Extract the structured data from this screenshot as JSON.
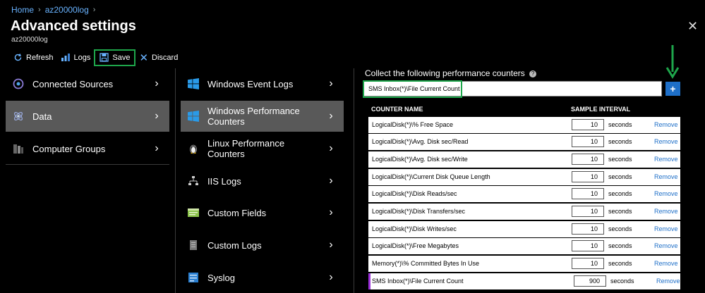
{
  "breadcrumb": {
    "home": "Home",
    "workspace": "az20000log"
  },
  "header": {
    "title": "Advanced settings",
    "subtitle": "az20000log"
  },
  "toolbar": {
    "refresh": "Refresh",
    "logs": "Logs",
    "save": "Save",
    "discard": "Discard"
  },
  "sidebar": {
    "items": [
      {
        "label": "Connected Sources",
        "icon": "plug-icon"
      },
      {
        "label": "Data",
        "icon": "data-icon",
        "selected": true
      },
      {
        "label": "Computer Groups",
        "icon": "server-group-icon"
      }
    ]
  },
  "datasources": {
    "items": [
      {
        "label": "Windows Event Logs",
        "icon": "windows-icon"
      },
      {
        "label": "Windows Performance Counters",
        "icon": "windows-icon",
        "selected": true
      },
      {
        "label": "Linux Performance Counters",
        "icon": "linux-icon"
      },
      {
        "label": "IIS Logs",
        "icon": "network-icon"
      },
      {
        "label": "Custom Fields",
        "icon": "fields-icon"
      },
      {
        "label": "Custom Logs",
        "icon": "log-icon"
      },
      {
        "label": "Syslog",
        "icon": "syslog-icon"
      }
    ]
  },
  "counters": {
    "collect_label": "Collect the following performance counters",
    "input_value": "SMS Inbox(*)\\File Current Count",
    "add_label": "+",
    "col_name": "COUNTER NAME",
    "col_interval": "SAMPLE INTERVAL",
    "seconds_label": "seconds",
    "remove_label": "Remove",
    "rows": [
      {
        "name": "LogicalDisk(*)\\% Free Space",
        "interval": "10"
      },
      {
        "name": "LogicalDisk(*)\\Avg. Disk sec/Read",
        "interval": "10"
      },
      {
        "name": "LogicalDisk(*)\\Avg. Disk sec/Write",
        "interval": "10"
      },
      {
        "name": "LogicalDisk(*)\\Current Disk Queue Length",
        "interval": "10"
      },
      {
        "name": "LogicalDisk(*)\\Disk Reads/sec",
        "interval": "10"
      },
      {
        "name": "LogicalDisk(*)\\Disk Transfers/sec",
        "interval": "10"
      },
      {
        "name": "LogicalDisk(*)\\Disk Writes/sec",
        "interval": "10"
      },
      {
        "name": "LogicalDisk(*)\\Free Megabytes",
        "interval": "10"
      },
      {
        "name": "Memory(*)\\% Committed Bytes In Use",
        "interval": "10"
      },
      {
        "name": "SMS Inbox(*)\\File Current Count",
        "interval": "900"
      }
    ]
  },
  "colors": {
    "accent": "#1e6fc8",
    "highlight": "#1ea64b",
    "selected_bg": "#595959",
    "new_row_marker": "#9b30d9"
  }
}
